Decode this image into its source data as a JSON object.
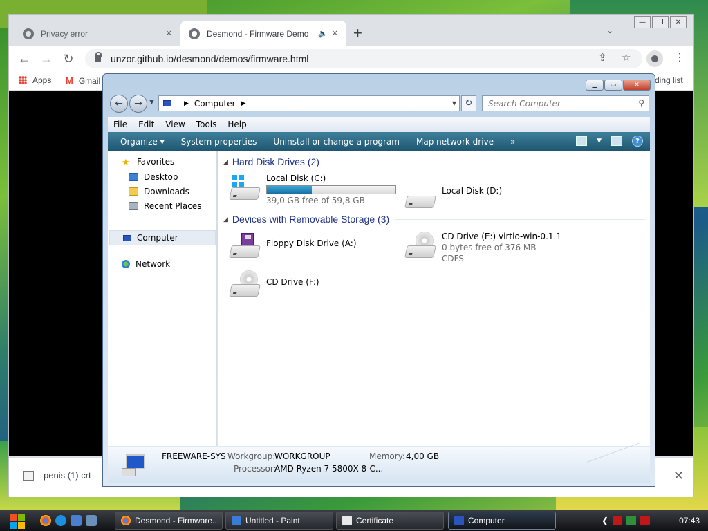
{
  "browser": {
    "tabs": [
      {
        "title": "Privacy error"
      },
      {
        "title": "Desmond - Firmware Demo"
      }
    ],
    "new_tab_glyph": "+",
    "url": "unzor.github.io/desmond/demos/firmware.html",
    "bookmarks": [
      {
        "label": "Apps"
      },
      {
        "label": "Gmail"
      }
    ],
    "bookmarks_right": "ding list",
    "download": {
      "filename": "penis (1).crt"
    }
  },
  "explorer": {
    "breadcrumb": "Computer",
    "search_placeholder": "Search Computer",
    "menu": [
      "File",
      "Edit",
      "View",
      "Tools",
      "Help"
    ],
    "commands": [
      "Organize ▾",
      "System properties",
      "Uninstall or change a program",
      "Map network drive",
      "»"
    ],
    "nav": {
      "favorites": "Favorites",
      "desktop": "Desktop",
      "downloads": "Downloads",
      "recent": "Recent Places",
      "computer": "Computer",
      "network": "Network"
    },
    "groups": {
      "hdd": "Hard Disk Drives (2)",
      "removable": "Devices with Removable Storage (3)"
    },
    "drives": {
      "c": {
        "name": "Local Disk (C:)",
        "free": "39,0 GB free of 59,8 GB",
        "used_fraction": 0.35
      },
      "d": {
        "name": "Local Disk (D:)"
      },
      "a": {
        "name": "Floppy Disk Drive (A:)"
      },
      "e": {
        "name": "CD Drive (E:) virtio-win-0.1.1",
        "free": "0 bytes free of 376 MB",
        "fs": "CDFS"
      },
      "f": {
        "name": "CD Drive (F:)"
      }
    },
    "details": {
      "computer_name": "FREEWARE-SYS",
      "workgroup_label": "Workgroup:",
      "workgroup": "WORKGROUP",
      "memory_label": "Memory:",
      "memory": "4,00 GB",
      "processor_label": "Processor:",
      "processor": "AMD Ryzen 7 5800X 8-C..."
    }
  },
  "taskbar": {
    "tasks": [
      {
        "label": "Desmond - Firmware..."
      },
      {
        "label": "Untitled - Paint"
      },
      {
        "label": "Certificate"
      },
      {
        "label": "Computer"
      }
    ],
    "clock": "07:43"
  },
  "colors": {
    "chrome_frame": "#dee1e6",
    "explorer_cmdbar": "#1d5570",
    "group_heading": "#1e3287",
    "capacity_fill": "#1a6fa2"
  }
}
